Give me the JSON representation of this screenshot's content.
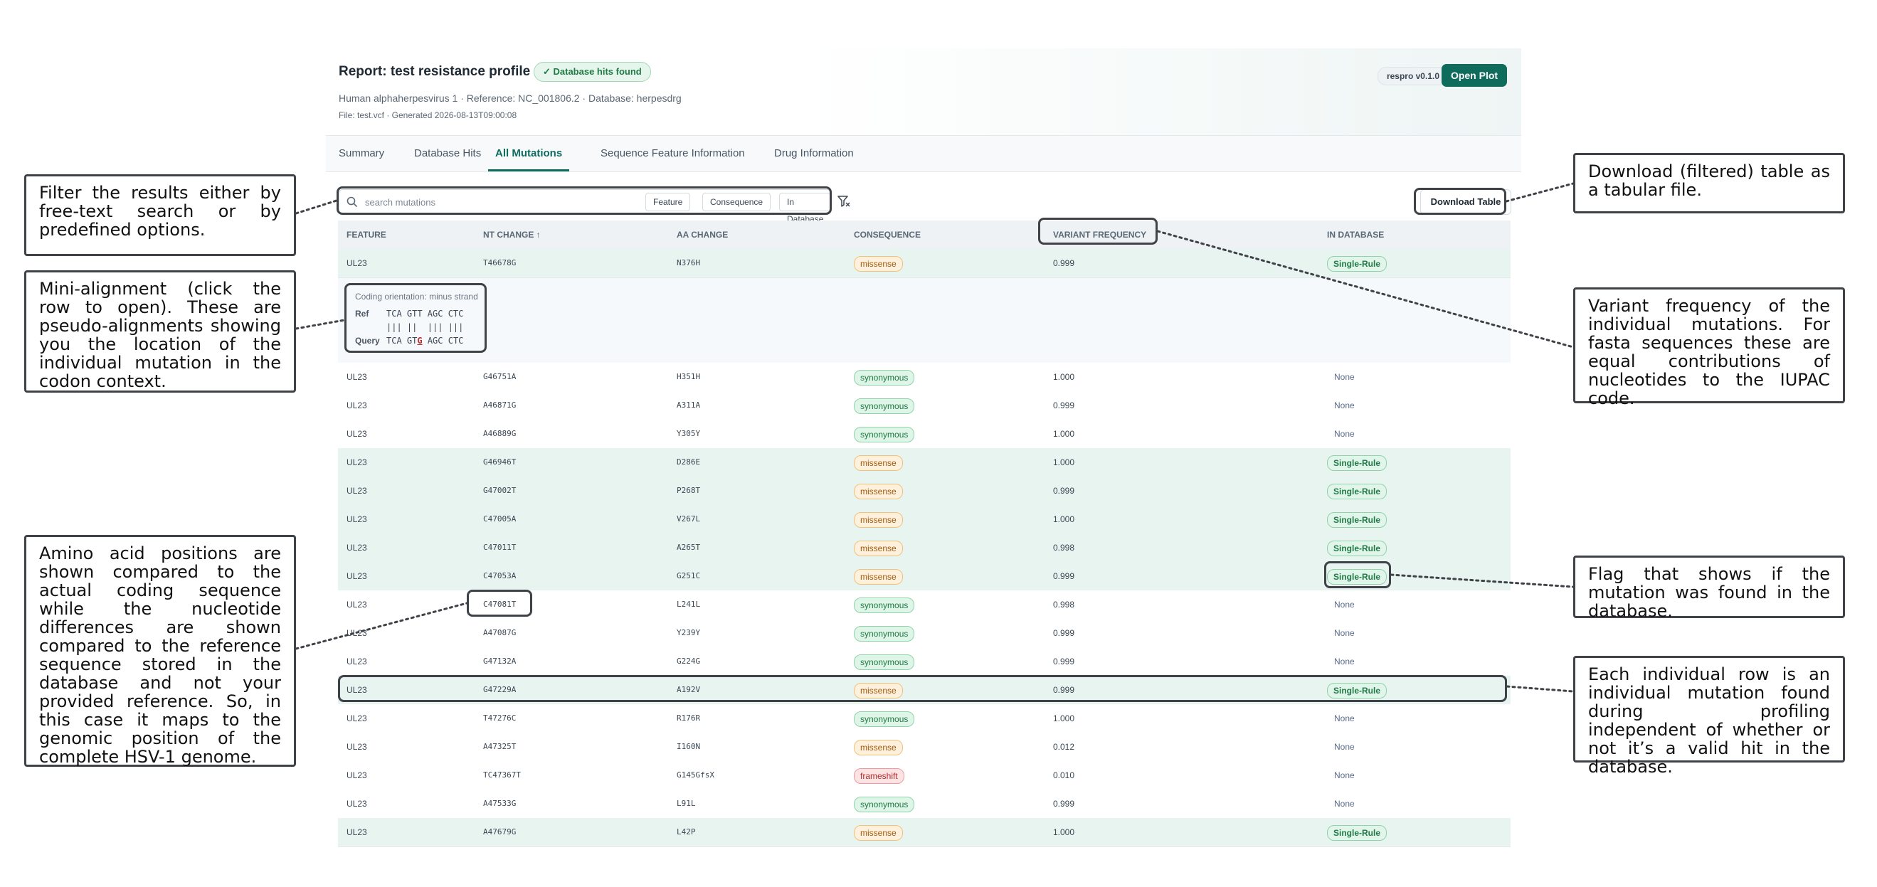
{
  "header": {
    "title": "Report: test resistance profile",
    "hits_badge": "✓ Database hits found",
    "subtitle": "Human alphaherpesvirus 1 · Reference: NC_001806.2 · Database: herpesdrg",
    "fileline": "File: test.vcf · Generated 2026-08-13T09:00:08",
    "version": "respro v0.1.0",
    "open_plot": "Open Plot"
  },
  "tabs": [
    {
      "label": "Summary"
    },
    {
      "label": "Database Hits"
    },
    {
      "label": "All Mutations",
      "active": true
    },
    {
      "label": "Sequence Feature Information"
    },
    {
      "label": "Drug Information"
    }
  ],
  "toolbar": {
    "search_placeholder": "search mutations",
    "filters": [
      "Feature",
      "Consequence",
      "In Database"
    ],
    "download_label": "Download Table"
  },
  "table": {
    "columns": [
      "FEATURE",
      "NT CHANGE ↑",
      "AA CHANGE",
      "CONSEQUENCE",
      "VARIANT FREQUENCY",
      "IN DATABASE"
    ],
    "rows": [
      {
        "feature": "UL23",
        "nt": "T46678G",
        "aa": "N376H",
        "consequence": "missense",
        "freq": "0.999",
        "db": "Single-Rule"
      },
      {
        "feature": "UL23",
        "nt": "G46751A",
        "aa": "H351H",
        "consequence": "synonymous",
        "freq": "1.000",
        "db": "None"
      },
      {
        "feature": "UL23",
        "nt": "A46871G",
        "aa": "A311A",
        "consequence": "synonymous",
        "freq": "0.999",
        "db": "None"
      },
      {
        "feature": "UL23",
        "nt": "A46889G",
        "aa": "Y305Y",
        "consequence": "synonymous",
        "freq": "1.000",
        "db": "None"
      },
      {
        "feature": "UL23",
        "nt": "G46946T",
        "aa": "D286E",
        "consequence": "missense",
        "freq": "1.000",
        "db": "Single-Rule"
      },
      {
        "feature": "UL23",
        "nt": "G47002T",
        "aa": "P268T",
        "consequence": "missense",
        "freq": "0.999",
        "db": "Single-Rule"
      },
      {
        "feature": "UL23",
        "nt": "C47005A",
        "aa": "V267L",
        "consequence": "missense",
        "freq": "1.000",
        "db": "Single-Rule"
      },
      {
        "feature": "UL23",
        "nt": "C47011T",
        "aa": "A265T",
        "consequence": "missense",
        "freq": "0.998",
        "db": "Single-Rule"
      },
      {
        "feature": "UL23",
        "nt": "C47053A",
        "aa": "G251C",
        "consequence": "missense",
        "freq": "0.999",
        "db": "Single-Rule"
      },
      {
        "feature": "UL23",
        "nt": "C47081T",
        "aa": "L241L",
        "consequence": "synonymous",
        "freq": "0.998",
        "db": "None"
      },
      {
        "feature": "UL23",
        "nt": "A47087G",
        "aa": "Y239Y",
        "consequence": "synonymous",
        "freq": "0.999",
        "db": "None"
      },
      {
        "feature": "UL23",
        "nt": "G47132A",
        "aa": "G224G",
        "consequence": "synonymous",
        "freq": "0.999",
        "db": "None"
      },
      {
        "feature": "UL23",
        "nt": "G47229A",
        "aa": "A192V",
        "consequence": "missense",
        "freq": "0.999",
        "db": "Single-Rule"
      },
      {
        "feature": "UL23",
        "nt": "T47276C",
        "aa": "R176R",
        "consequence": "synonymous",
        "freq": "1.000",
        "db": "None"
      },
      {
        "feature": "UL23",
        "nt": "A47325T",
        "aa": "I160N",
        "consequence": "missense",
        "freq": "0.012",
        "db": "None"
      },
      {
        "feature": "UL23",
        "nt": "TC47367T",
        "aa": "G145GfsX",
        "consequence": "frameshift",
        "freq": "0.010",
        "db": "None"
      },
      {
        "feature": "UL23",
        "nt": "A47533G",
        "aa": "L91L",
        "consequence": "synonymous",
        "freq": "0.999",
        "db": "None"
      },
      {
        "feature": "UL23",
        "nt": "A47679G",
        "aa": "L42P",
        "consequence": "missense",
        "freq": "1.000",
        "db": "Single-Rule"
      }
    ]
  },
  "alignment": {
    "title": "Coding orientation: minus strand",
    "ref_label": "Ref",
    "query_label": "Query",
    "ref_seq": "TCA GTT AGC CTC",
    "match_line": "||| ||  ||| |||",
    "query_pre": "TCA GT",
    "query_mut": "G",
    "query_post": " AGC CTC"
  },
  "callouts": {
    "filter": "Filter the results either by free-text search or by predefined options.",
    "alignment": "Mini-alignment (click the row to open). These are pseudo-alignments showing you the location of the individual mutation in the codon context.",
    "positions": "Amino acid positions are shown compared to the actual coding sequence while the nucleotide differences are shown compared to the reference sequence stored in the database and not your provided reference. So, in this case it maps to the genomic position of the complete HSV-1 genome.",
    "download": "Download (filtered) table as a tabular file.",
    "frequency": "Variant frequency of the individual mutations. For fasta sequences these are equal contributions of nucleotides to the IUPAC code.",
    "flag": "Flag that shows if the mutation was found in the database.",
    "row": "Each individual row is an individual mutation found during profiling independent of whether or not it’s a valid hit in the database."
  }
}
